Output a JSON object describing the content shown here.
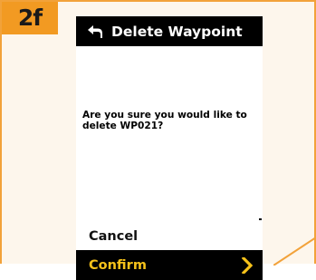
{
  "step": {
    "label": "2f"
  },
  "screen": {
    "title": "Delete Waypoint",
    "back_icon": "back-arrow-icon",
    "message": "Are you sure you would like to delete WP021?",
    "cancel_label": "Cancel",
    "confirm_label": "Confirm",
    "confirm_icon": "chevron-right-icon"
  },
  "colors": {
    "frame_border": "#f2a23a",
    "frame_bg": "#fdf6ec",
    "badge": "#f29a22",
    "title_bar": "#000000",
    "confirm_text": "#f6c21a",
    "chevron": "#f6c21a"
  }
}
